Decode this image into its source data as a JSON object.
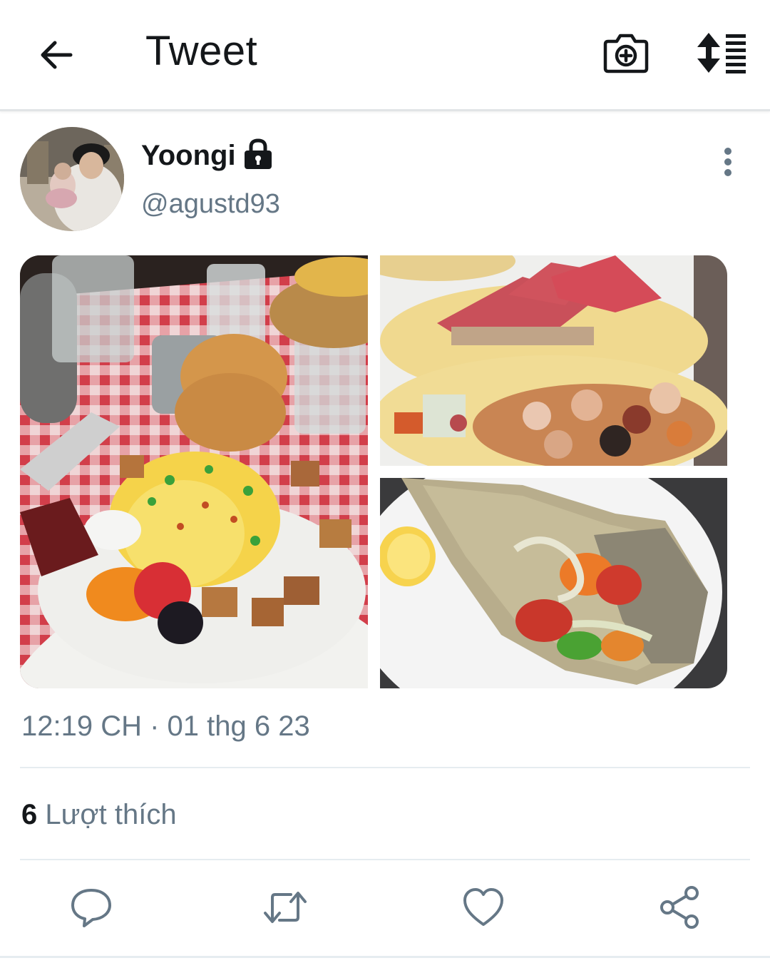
{
  "header": {
    "title": "Tweet",
    "back_icon": "arrow-left-icon",
    "camera_icon": "camera-plus-icon",
    "sort_icon": "sort-list-icon"
  },
  "tweet": {
    "author": {
      "display_name": "Yoongi",
      "handle": "@agustd93",
      "protected_icon": "lock-icon"
    },
    "media": [
      {
        "alt": "breakfast-poutine-plate"
      },
      {
        "alt": "tuna-octopus-tacos"
      },
      {
        "alt": "grilled-fish-with-vegetables"
      }
    ],
    "timestamp": "12:19 CH · 01 thg 6 23",
    "likes": {
      "count": "6",
      "label": "Lượt thích"
    },
    "actions": [
      "reply-icon",
      "retweet-icon",
      "heart-icon",
      "share-icon"
    ]
  },
  "colors": {
    "text_primary": "#14171a",
    "text_secondary": "#657786",
    "divider": "#e6ecf0"
  }
}
